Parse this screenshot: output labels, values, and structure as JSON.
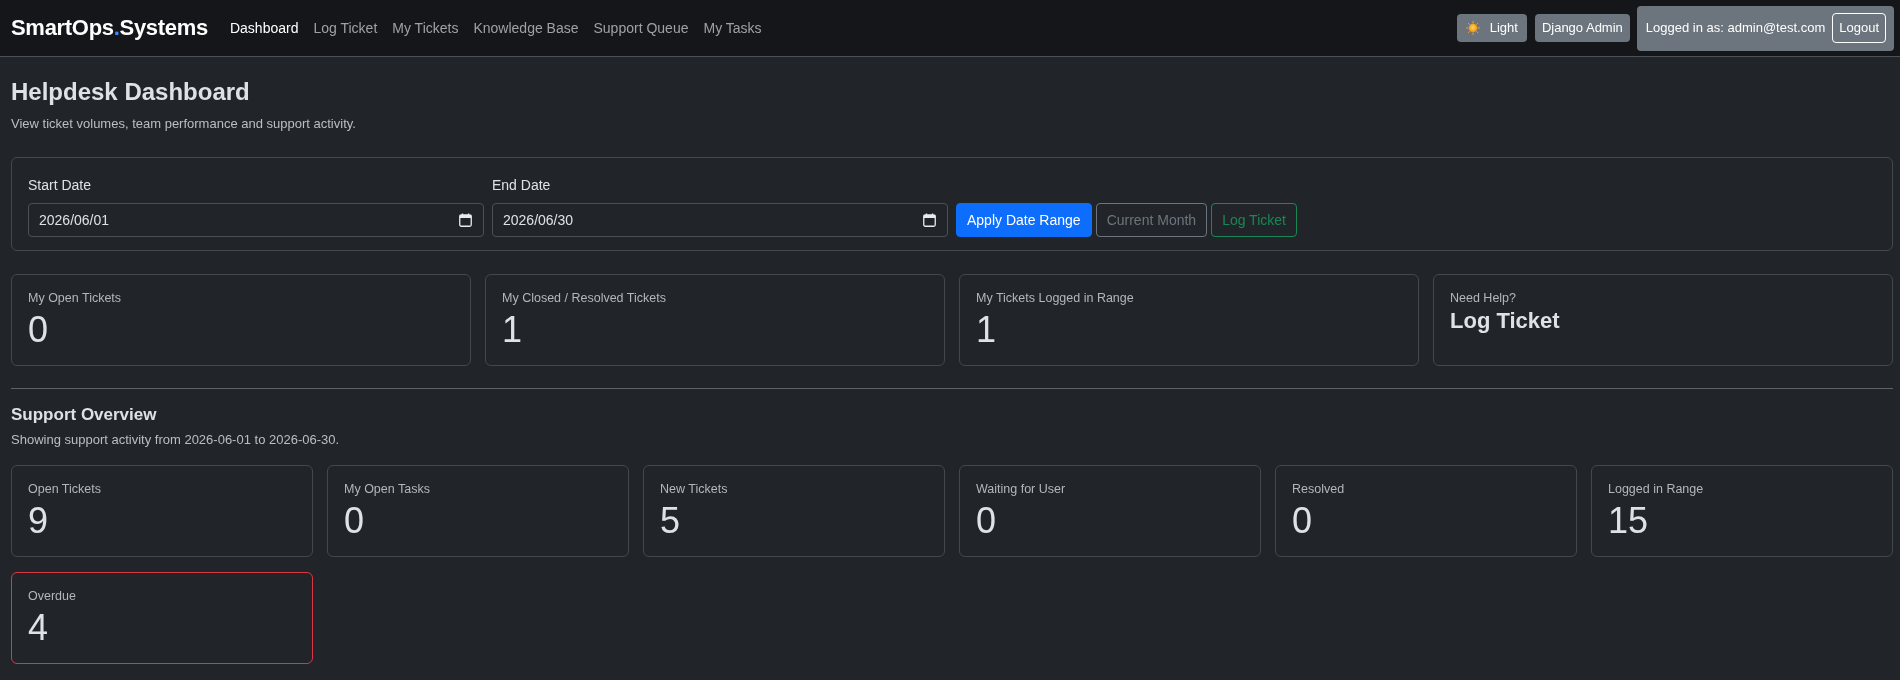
{
  "navbar": {
    "brand": [
      {
        "text": "SmartOps",
        "color": "#ffffff"
      },
      {
        "text": ".",
        "color": "#3d8bfd"
      },
      {
        "text": "Systems",
        "color": "#ffffff"
      }
    ],
    "links": [
      {
        "label": "Dashboard",
        "selected": true
      },
      {
        "label": "Log Ticket",
        "selected": false
      },
      {
        "label": "My Tickets",
        "selected": false
      },
      {
        "label": "Knowledge Base",
        "selected": false
      },
      {
        "label": "Support Queue",
        "selected": false
      },
      {
        "label": "My Tasks",
        "selected": false
      }
    ],
    "theme_toggle": {
      "label": "Light"
    },
    "admin_button": {
      "label": "Django Admin"
    },
    "user": {
      "text": "Logged in as: admin@test.com",
      "logout": "Logout"
    }
  },
  "header": {
    "title": "Helpdesk Dashboard",
    "subtitle": "View ticket volumes, team performance and support activity."
  },
  "date_filter": {
    "fields": [
      {
        "label": "Start Date",
        "value": "2026/06/01"
      },
      {
        "label": "End Date",
        "value": "2026/06/30"
      }
    ],
    "buttons": [
      {
        "label": "Apply Date Range",
        "kind": "primary"
      },
      {
        "label": "Current Month",
        "kind": "secondary"
      },
      {
        "label": "Log Ticket",
        "kind": "success"
      }
    ]
  },
  "my_stats": [
    {
      "kind": "stat",
      "label": "My Open Tickets",
      "value": "0"
    },
    {
      "kind": "stat",
      "label": "My Closed / Resolved Tickets",
      "value": "1"
    },
    {
      "kind": "stat",
      "label": "My Tickets Logged in Range",
      "value": "1"
    },
    {
      "kind": "link",
      "label": "Need Help?",
      "value": "Log Ticket"
    }
  ],
  "overview": {
    "title": "Support Overview",
    "subtitle": "Showing support activity from 2026-06-01 to 2026-06-30.",
    "cards": [
      {
        "label": "Open Tickets",
        "value": "9",
        "alert": false
      },
      {
        "label": "My Open Tasks",
        "value": "0",
        "alert": false
      },
      {
        "label": "New Tickets",
        "value": "5",
        "alert": false
      },
      {
        "label": "Waiting for User",
        "value": "0",
        "alert": false
      },
      {
        "label": "Resolved",
        "value": "0",
        "alert": false
      },
      {
        "label": "Logged in Range",
        "value": "15",
        "alert": false
      },
      {
        "label": "Overdue",
        "value": "4",
        "alert": true
      }
    ]
  }
}
